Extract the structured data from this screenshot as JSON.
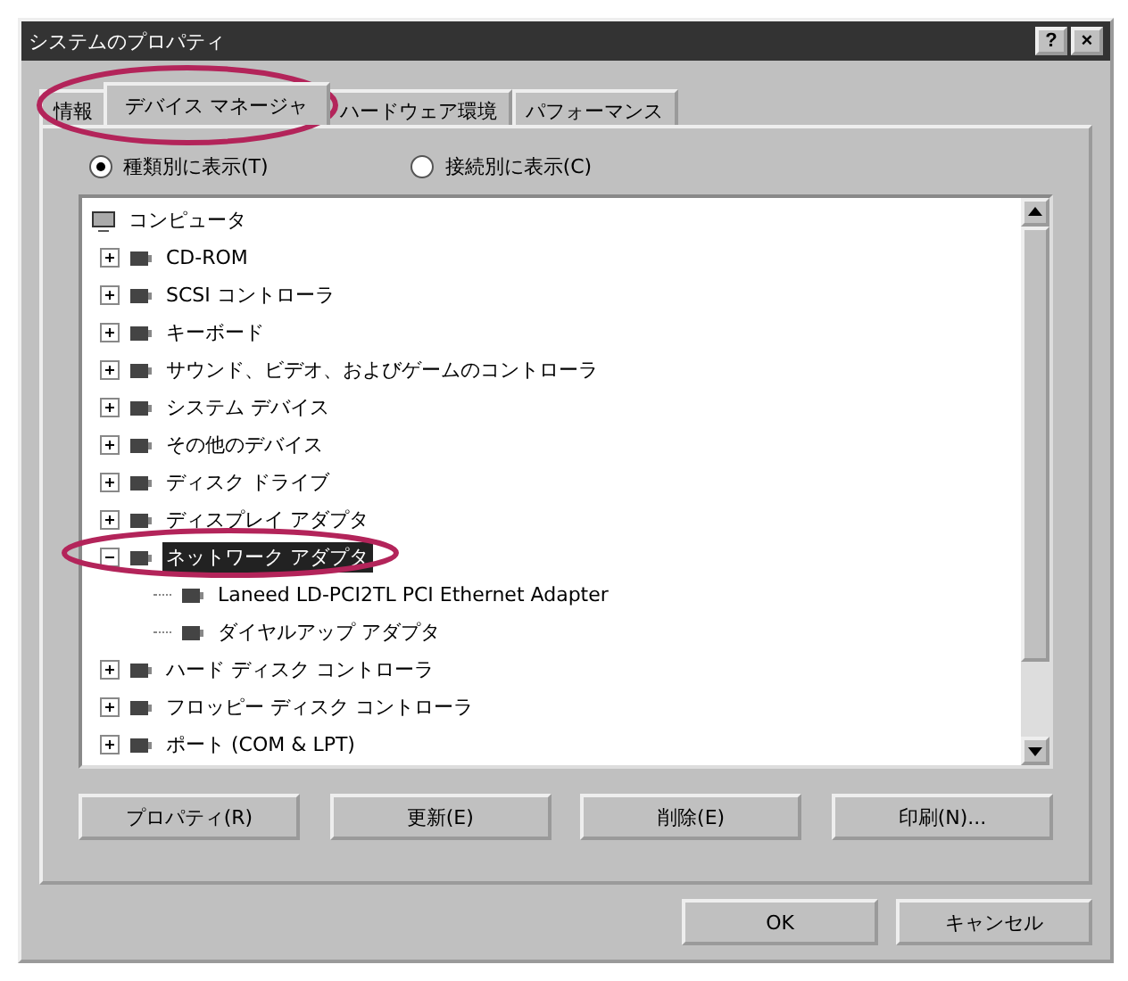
{
  "window": {
    "title": "システムのプロパティ",
    "help_button": "?",
    "close_button": "×"
  },
  "tabs": [
    {
      "label": "情報",
      "selected": false
    },
    {
      "label": "デバイス マネージャ",
      "selected": true
    },
    {
      "label": "ハードウェア環境",
      "selected": false
    },
    {
      "label": "パフォーマンス",
      "selected": false
    }
  ],
  "view_options": [
    {
      "label": "種類別に表示(T)",
      "selected": true
    },
    {
      "label": "接続別に表示(C)",
      "selected": false
    }
  ],
  "tree": {
    "label": "コンピュータ",
    "children": [
      {
        "label": "CD-ROM",
        "expanded": false,
        "selected": false
      },
      {
        "label": "SCSI コントローラ",
        "expanded": false,
        "selected": false
      },
      {
        "label": "キーボード",
        "expanded": false,
        "selected": false
      },
      {
        "label": "サウンド、ビデオ、およびゲームのコントローラ",
        "expanded": false,
        "selected": false
      },
      {
        "label": "システム デバイス",
        "expanded": false,
        "selected": false
      },
      {
        "label": "その他のデバイス",
        "expanded": false,
        "selected": false
      },
      {
        "label": "ディスク ドライブ",
        "expanded": false,
        "selected": false
      },
      {
        "label": "ディスプレイ アダプタ",
        "expanded": false,
        "selected": false
      },
      {
        "label": "ネットワーク アダプタ",
        "expanded": true,
        "selected": true,
        "children": [
          {
            "label": "Laneed LD-PCI2TL PCI Ethernet Adapter",
            "selected": false
          },
          {
            "label": "ダイヤルアップ アダプタ",
            "selected": false
          }
        ]
      },
      {
        "label": "ハード ディスク コントローラ",
        "expanded": false,
        "selected": false
      },
      {
        "label": "フロッピー ディスク コントローラ",
        "expanded": false,
        "selected": false
      },
      {
        "label": "ポート (COM & LPT)",
        "expanded": false,
        "selected": false
      }
    ]
  },
  "device_buttons": [
    "プロパティ(R)",
    "更新(E)",
    "削除(E)",
    "印刷(N)..."
  ],
  "dialog_buttons": [
    "OK",
    "キャンセル"
  ]
}
